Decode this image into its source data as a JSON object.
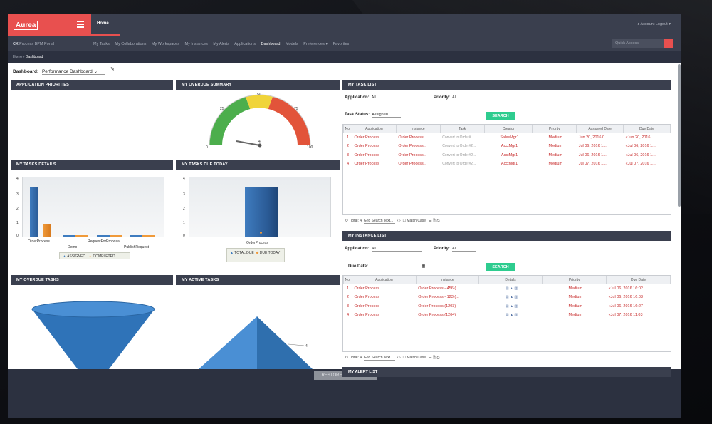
{
  "header": {
    "logo": "Aurea",
    "home_tab": "Home",
    "account": "Account",
    "logout": "Logout"
  },
  "nav": {
    "brand_prefix": "CX",
    "brand": "Process BPM Portal",
    "links": [
      "My Tasks",
      "My Collaborations",
      "My Workspaces",
      "My Instances",
      "My Alerts",
      "Applications",
      "Dashboard",
      "Models",
      "Preferences ▾",
      "Favorites"
    ],
    "quick_access": "Quick Access"
  },
  "breadcrumb": [
    "Home",
    "Dashboard"
  ],
  "dashboard": {
    "label": "Dashboard:",
    "value": "Performance Dashboard"
  },
  "panels": {
    "app_priorities": "APPLICATION PRIORITIES",
    "overdue_summary": "MY OVERDUE SUMMARY",
    "tasks_details": "MY TASKS DETAILS",
    "tasks_due_today": "MY TASKS DUE TODAY",
    "overdue_tasks": "MY OVERDUE TASKS",
    "active_tasks": "MY ACTIVE TASKS"
  },
  "gauge": {
    "ticks": [
      "0",
      "25",
      "50",
      "75",
      "100"
    ],
    "value": "4"
  },
  "tasks_details": {
    "yticks": [
      "4",
      "3",
      "2",
      "1",
      "0"
    ],
    "categories": [
      "OrderProcess",
      "Demo",
      "RequestForProposal",
      "PublishRequest"
    ],
    "legend": [
      "ASSIGNED",
      "COMPLETED"
    ]
  },
  "tasks_due_today": {
    "yticks": [
      "4",
      "3",
      "2",
      "1",
      "0"
    ],
    "categories": [
      "OrderProcess"
    ],
    "legend": [
      "TOTAL DUE",
      "DUE TODAY"
    ]
  },
  "active_tasks": {
    "value": "4"
  },
  "task_list": {
    "title": "MY TASK LIST",
    "application_label": "Application:",
    "application_value": "All",
    "priority_label": "Priority:",
    "priority_value": "All",
    "status_label": "Task Status:",
    "status_value": "Assigned",
    "search_label": "SEARCH",
    "columns": [
      "No.",
      "Application",
      "Instance",
      "Task",
      "Creator",
      "Priority",
      "Assigned Date",
      "Due Date"
    ],
    "rows": [
      {
        "no": "1",
        "application": "Order Process",
        "instance": "Order Process...",
        "task": "Convert to Order#...",
        "creator": "SalesMgr1",
        "priority": "Medium",
        "assigned": "Jun 20, 2016 0...",
        "due": "«Jun 20, 2016..."
      },
      {
        "no": "2",
        "application": "Order Process",
        "instance": "Order Process...",
        "task": "Convert to Order#2...",
        "creator": "AcctMgr1",
        "priority": "Medium",
        "assigned": "Jul 06, 2016 1...",
        "due": "«Jul 06, 2016 1..."
      },
      {
        "no": "3",
        "application": "Order Process",
        "instance": "Order Process...",
        "task": "Convert to Order#2...",
        "creator": "AcctMgr1",
        "priority": "Medium",
        "assigned": "Jul 06, 2016 1...",
        "due": "«Jul 06, 2016 1..."
      },
      {
        "no": "4",
        "application": "Order Process",
        "instance": "Order Process...",
        "task": "Convert to Order#2...",
        "creator": "AcctMgr1",
        "priority": "Medium",
        "assigned": "Jul 07, 2016 1...",
        "due": "«Jul 07, 2016 1..."
      }
    ],
    "footer": {
      "total": "Total: 4",
      "search_placeholder": "Grid Search Text...",
      "match_case": "Match Case"
    }
  },
  "instance_list": {
    "title": "MY INSTANCE LIST",
    "application_label": "Application:",
    "application_value": "All",
    "priority_label": "Priority:",
    "priority_value": "All",
    "due_date_label": "Due Date:",
    "search_label": "SEARCH",
    "columns": [
      "No.",
      "Application",
      "Instance",
      "Details",
      "Priority",
      "Due Date"
    ],
    "rows": [
      {
        "no": "1",
        "application": "Order Process",
        "instance": "Order Process - 456 (...",
        "priority": "Medium",
        "due": "«Jul 06, 2016 16:02"
      },
      {
        "no": "2",
        "application": "Order Process",
        "instance": "Order Process - 123 (...",
        "priority": "Medium",
        "due": "«Jul 06, 2016 16:03"
      },
      {
        "no": "3",
        "application": "Order Process",
        "instance": "Order Process (1203)",
        "priority": "Medium",
        "due": "«Jul 06, 2016 16:27"
      },
      {
        "no": "4",
        "application": "Order Process",
        "instance": "Order Process (1204)",
        "priority": "Medium",
        "due": "«Jul 07, 2016 11:03"
      }
    ],
    "footer": {
      "total": "Total: 4",
      "search_placeholder": "Grid Search Text...",
      "match_case": "Match Case"
    }
  },
  "alert_list": {
    "title": "MY ALERT LIST"
  },
  "footer": {
    "restore_label": "RESTORE TO DEFAULT"
  },
  "colors": {
    "accent": "#e8504f",
    "header_dark": "#3a3f4e",
    "search_green": "#2ecc8f",
    "series_blue": "#2f73b8",
    "series_orange": "#f09a3a",
    "row_text": "#c62828"
  }
}
